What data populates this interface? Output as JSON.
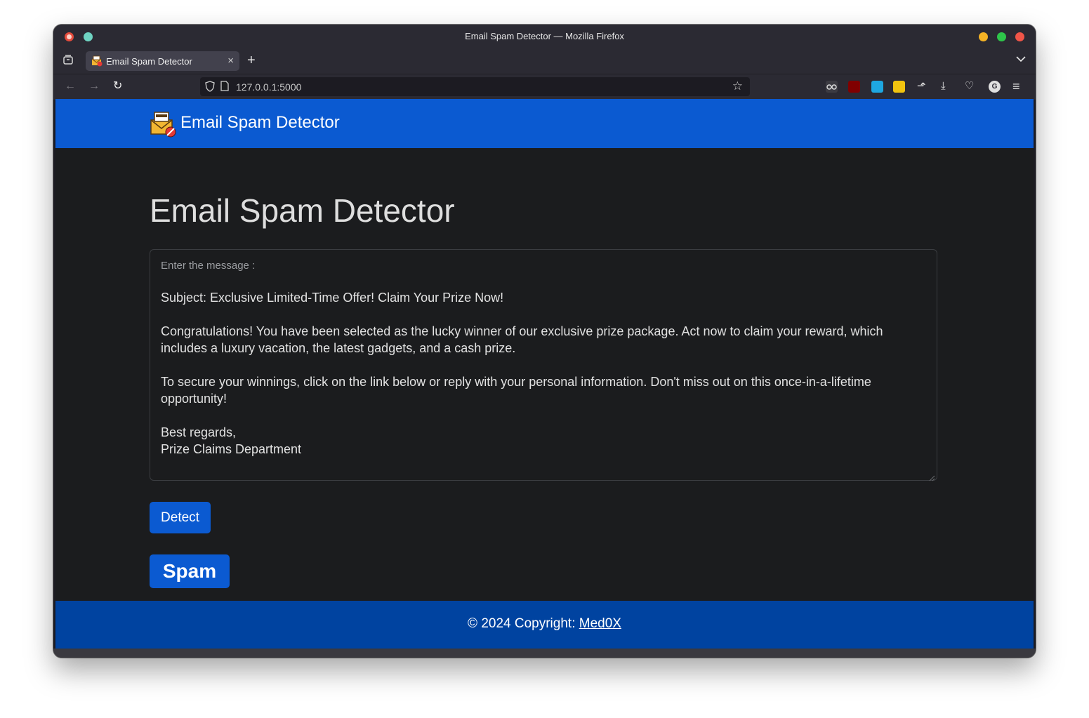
{
  "window": {
    "title": "Email Spam Detector — Mozilla Firefox"
  },
  "tabs": [
    {
      "label": "Email Spam Detector",
      "close": "×"
    }
  ],
  "tabstrip": {
    "new_tab": "+",
    "list_all": "⌄"
  },
  "nav": {
    "url": "127.0.0.1:5000",
    "back": "←",
    "forward": "→",
    "reload": "↻",
    "bookmark": "☆"
  },
  "toolbar": {
    "extensions_icon": "⬏",
    "downloads": "⤓",
    "pocket": "♡",
    "account": "G",
    "menu": "≡"
  },
  "site": {
    "brand": "Email Spam Detector",
    "heading": "Email Spam Detector",
    "form": {
      "label": "Enter the message :",
      "message": "Subject: Exclusive Limited-Time Offer! Claim Your Prize Now!\n\nCongratulations! You have been selected as the lucky winner of our exclusive prize package. Act now to claim your reward, which includes a luxury vacation, the latest gadgets, and a cash prize.\n\nTo secure your winnings, click on the link below or reply with your personal information. Don't miss out on this once-in-a-lifetime opportunity!\n\nBest regards,\nPrize Claims Department",
      "submit_label": "Detect"
    },
    "result": "Spam",
    "footer": {
      "copyright": "© 2024 Copyright: ",
      "author": "Med0X"
    }
  },
  "colors": {
    "primary": "#0b5ad1",
    "footer": "#0043a0",
    "background": "#1b1c1e"
  }
}
